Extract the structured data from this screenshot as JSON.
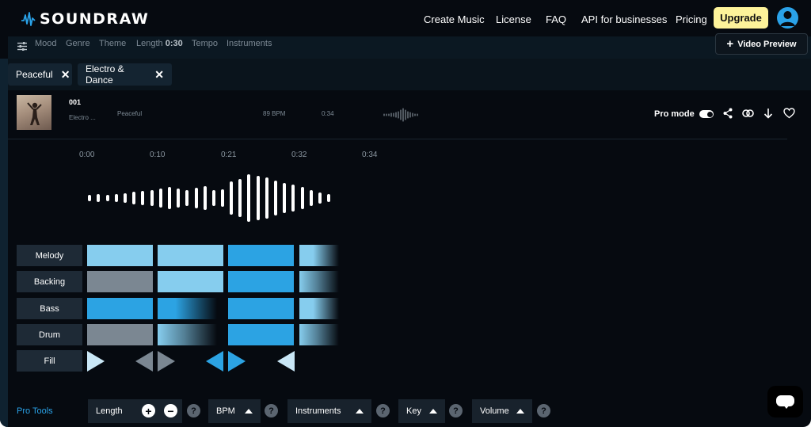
{
  "header": {
    "brand": "SOUNDRAW",
    "nav": [
      "Create Music",
      "License",
      "FAQ",
      "API for businesses",
      "Pricing"
    ],
    "upgrade_label": "Upgrade"
  },
  "filters": {
    "items": [
      "Mood",
      "Genre",
      "Theme"
    ],
    "length_label": "Length",
    "length_value": "0:30",
    "items2": [
      "Tempo",
      "Instruments"
    ],
    "video_preview_label": "Video Preview"
  },
  "chips": [
    {
      "label": "Peaceful"
    },
    {
      "label": "Electro & Dance"
    }
  ],
  "track": {
    "number": "001",
    "genre": "Electro ...",
    "mood": "Peaceful",
    "bpm": "89 BPM",
    "duration": "0:34",
    "pro_mode_label": "Pro mode",
    "pro_mode_on": true
  },
  "timeline": {
    "marks": [
      "0:00",
      "0:10",
      "0:21",
      "0:32",
      "0:34"
    ]
  },
  "editor": {
    "tracks": [
      {
        "label": "Melody"
      },
      {
        "label": "Backing"
      },
      {
        "label": "Bass"
      },
      {
        "label": "Drum"
      },
      {
        "label": "Fill"
      }
    ]
  },
  "colors": {
    "accent": "#2ca3e3",
    "light_block": "#86cdee",
    "muted_block": "#7b8792",
    "upgrade_bg": "#fdf39a",
    "background": "#060a10"
  },
  "pro_tools": {
    "label": "Pro Tools",
    "length": "Length",
    "bpm": "BPM",
    "instruments": "Instruments",
    "key": "Key",
    "volume": "Volume",
    "help": "?"
  }
}
